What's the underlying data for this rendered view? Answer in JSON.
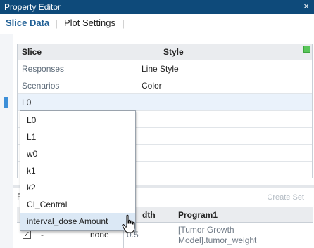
{
  "window": {
    "title": "Property Editor",
    "close_glyph": "×"
  },
  "tabs": [
    {
      "label": "Slice Data",
      "active": true
    },
    {
      "label": "Plot Settings",
      "active": false
    }
  ],
  "tab_separator": "|",
  "slice_grid": {
    "columns": [
      "Slice",
      "Style"
    ],
    "rows": [
      {
        "slice": "Responses",
        "style": "Line Style"
      },
      {
        "slice": "Scenarios",
        "style": "Color"
      },
      {
        "slice": "L0",
        "style": ""
      }
    ]
  },
  "dropdown": {
    "options": [
      "L0",
      "L1",
      "w0",
      "k1",
      "k2",
      "CI_Central",
      "interval_dose Amount"
    ],
    "hovered": "interval_dose Amount"
  },
  "lower": {
    "label": "R",
    "create_set": "Create Set",
    "columns": [
      "",
      "",
      "dth",
      "Program1"
    ],
    "row": {
      "check": "✓",
      "dash": "-",
      "style": "none",
      "width": "0.5",
      "program": "[Tumor Growth Model].tumor_weight"
    }
  },
  "colors": {
    "title_bar": "#0e4a7a",
    "active_tab": "#1f5f95",
    "status_green": "#59c65a"
  }
}
